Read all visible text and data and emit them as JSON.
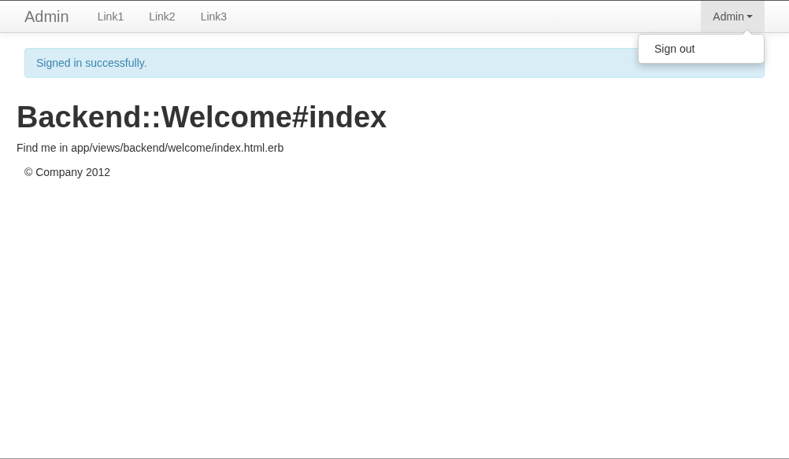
{
  "navbar": {
    "brand": "Admin",
    "links": [
      {
        "label": "Link1"
      },
      {
        "label": "Link2"
      },
      {
        "label": "Link3"
      }
    ],
    "user_menu": {
      "label": "Admin",
      "expanded": true,
      "items": [
        {
          "label": "Sign out"
        }
      ]
    }
  },
  "alert": {
    "kind": "info",
    "message": "Signed in successfully."
  },
  "heading": "Backend::Welcome#index",
  "body_text": "Find me in app/views/backend/welcome/index.html.erb",
  "footer": "© Company 2012"
}
